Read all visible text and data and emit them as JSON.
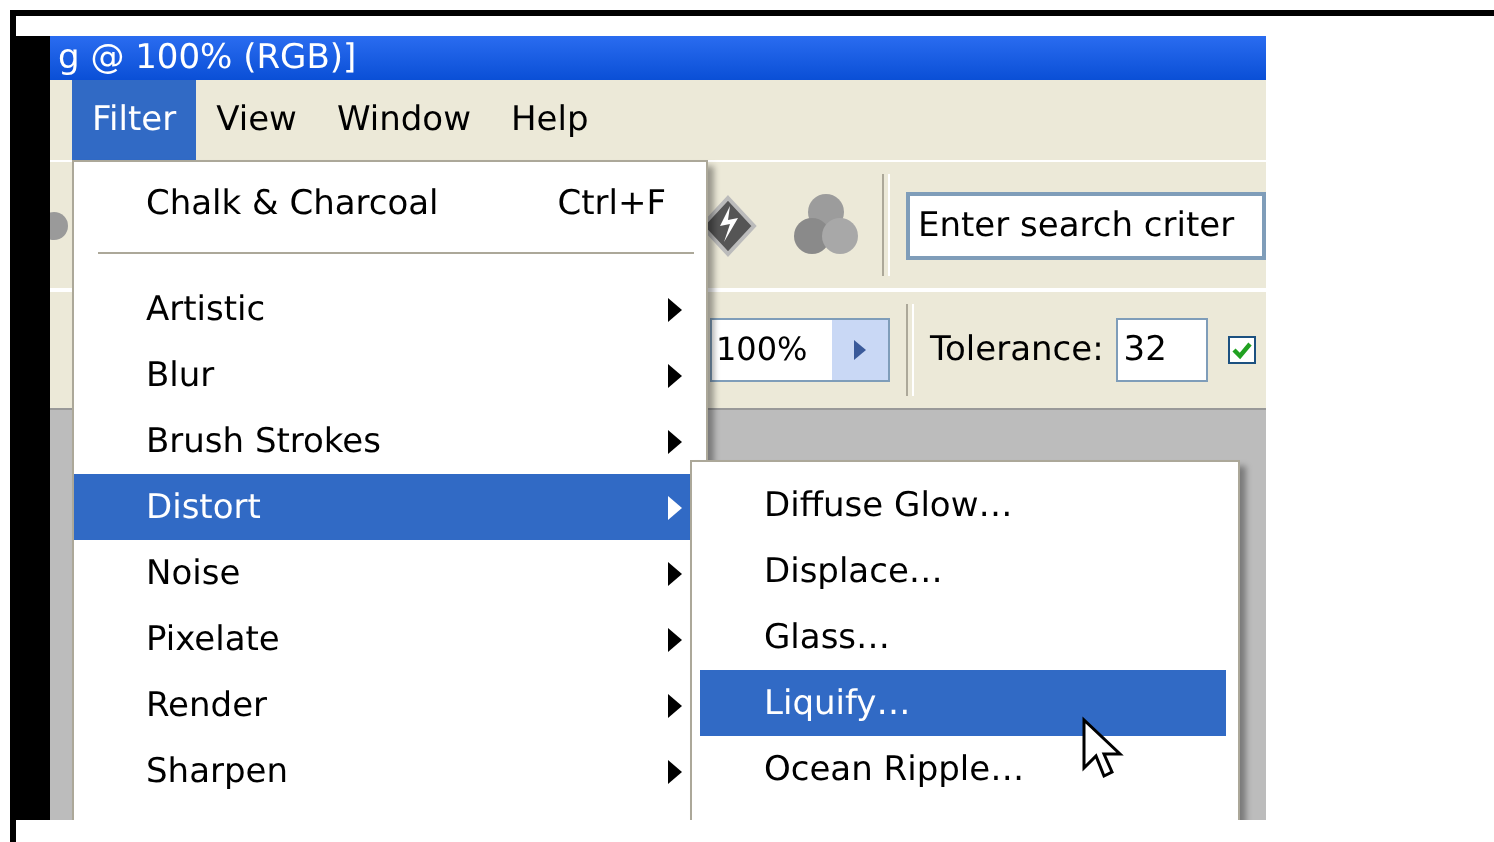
{
  "window": {
    "title": "g @ 100% (RGB)]"
  },
  "menu_bar": [
    {
      "label": "Filter",
      "selected": true
    },
    {
      "label": "View",
      "selected": false
    },
    {
      "label": "Window",
      "selected": false
    },
    {
      "label": "Help",
      "selected": false
    }
  ],
  "toolbar": {
    "search": {
      "placeholder": "Enter search criter"
    }
  },
  "options_bar": {
    "zoom": "100%",
    "tolerance_label": "Tolerance:",
    "tolerance": "32",
    "anti_alias": {
      "checked": true
    }
  },
  "filter_menu": {
    "last_filter": {
      "label": "Chalk & Charcoal",
      "shortcut": "Ctrl+F"
    },
    "items": [
      {
        "label": "Artistic",
        "selected": false,
        "submenu": true
      },
      {
        "label": "Blur",
        "selected": false,
        "submenu": true
      },
      {
        "label": "Brush Strokes",
        "selected": false,
        "submenu": true
      },
      {
        "label": "Distort",
        "selected": true,
        "submenu": true
      },
      {
        "label": "Noise",
        "selected": false,
        "submenu": true
      },
      {
        "label": "Pixelate",
        "selected": false,
        "submenu": true
      },
      {
        "label": "Render",
        "selected": false,
        "submenu": true
      },
      {
        "label": "Sharpen",
        "selected": false,
        "submenu": true
      }
    ]
  },
  "distort_submenu": {
    "items": [
      {
        "label": "Diffuse Glow…",
        "selected": false
      },
      {
        "label": "Displace…",
        "selected": false
      },
      {
        "label": "Glass…",
        "selected": false
      },
      {
        "label": "Liquify…",
        "selected": true
      },
      {
        "label": "Ocean Ripple…",
        "selected": false
      }
    ]
  }
}
